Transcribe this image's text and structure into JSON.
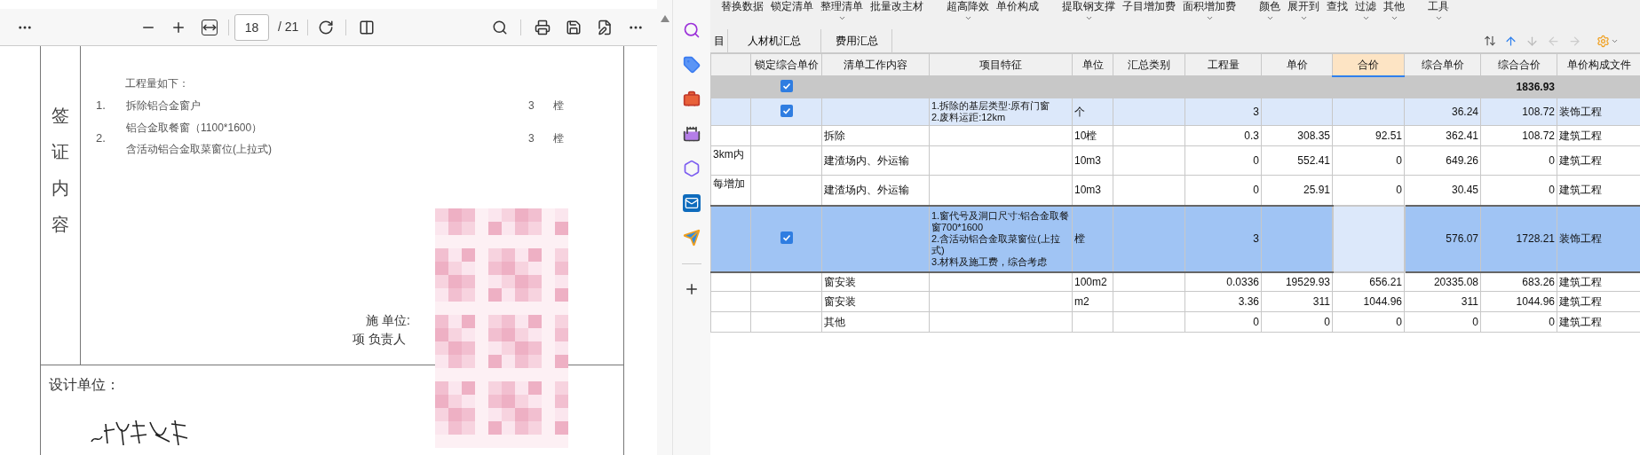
{
  "pdf": {
    "toolbar": {
      "page": "18",
      "total": "/ 21"
    },
    "page": {
      "side_label": "签证内容",
      "heading": "工程量如下：",
      "items": [
        {
          "number": "1.",
          "lines": [
            "拆除铝合金窗户"
          ],
          "qty": "3",
          "unit": "樘"
        },
        {
          "number": "2.",
          "lines": [
            "铝合金取餐窗（1100*1600）",
            "含活动铝合金取菜窗位(上拉式)"
          ],
          "qty": "3",
          "unit": "樘"
        }
      ],
      "contractor_label": "施 单位:",
      "manager_label": "项 负责人",
      "design_label": "设计单位："
    }
  },
  "app": {
    "toolbar_groups": [
      [
        {
          "label": "替换数据",
          "menu": false
        },
        {
          "label": "锁定清单",
          "menu": false
        },
        {
          "label": "整理清单",
          "menu": true
        },
        {
          "label": "批量改主材",
          "menu": false
        }
      ],
      [
        {
          "label": "超高降效",
          "menu": true
        },
        {
          "label": "单价构成",
          "menu": false
        }
      ],
      [
        {
          "label": "提取钢支撑",
          "menu": true
        },
        {
          "label": "子目增加费",
          "menu": false
        },
        {
          "label": "面积增加费",
          "menu": true
        }
      ],
      [
        {
          "label": "颜色",
          "menu": true
        },
        {
          "label": "展开到",
          "menu": true
        },
        {
          "label": "查找",
          "menu": false
        },
        {
          "label": "过滤",
          "menu": true
        },
        {
          "label": "其他",
          "menu": true
        }
      ],
      [
        {
          "label": "工具",
          "menu": true
        }
      ]
    ],
    "tabs": [
      {
        "label": "目",
        "selected": false
      },
      {
        "label": "人材机汇总",
        "selected": false
      },
      {
        "label": "费用汇总",
        "selected": false
      }
    ],
    "table": {
      "columns": [
        {
          "label": "锁定综合单价",
          "selected": false
        },
        {
          "label": "清单工作内容",
          "selected": false
        },
        {
          "label": "项目特征",
          "selected": false
        },
        {
          "label": "单位",
          "selected": false
        },
        {
          "label": "汇总类别",
          "selected": false
        },
        {
          "label": "工程量",
          "selected": false
        },
        {
          "label": "单价",
          "selected": false
        },
        {
          "label": "合价",
          "selected": true
        },
        {
          "label": "综合单价",
          "selected": false
        },
        {
          "label": "综合合价",
          "selected": false
        },
        {
          "label": "单价构成文件",
          "selected": false
        }
      ],
      "rows": [
        {
          "kind": "summary",
          "selected": false,
          "locked": true,
          "cells": [
            null,
            null,
            null,
            null,
            null,
            null,
            null,
            null,
            null,
            "1836.93",
            null
          ]
        },
        {
          "kind": "item",
          "selected": false,
          "locked": true,
          "cells": [
            null,
            null,
            "1.拆除的基层类型:原有门窗\n2.废料运距:12km",
            "个",
            null,
            "3",
            null,
            null,
            "36.24",
            "108.72",
            "装饰工程"
          ]
        },
        {
          "kind": "sub",
          "selected": false,
          "cells": [
            null,
            "拆除",
            null,
            "10樘",
            null,
            "0.3",
            "308.35",
            "92.51",
            "362.41",
            "108.72",
            "建筑工程"
          ]
        },
        {
          "kind": "sub",
          "selected": false,
          "row_header": "3km内",
          "cells": [
            null,
            "建渣场内、外运输",
            null,
            "10m3",
            null,
            "0",
            "552.41",
            "0",
            "649.26",
            "0",
            "建筑工程"
          ]
        },
        {
          "kind": "sub",
          "selected": false,
          "row_header": "每增加",
          "cells": [
            null,
            "建渣场内、外运输",
            null,
            "10m3",
            null,
            "0",
            "25.91",
            "0",
            "30.45",
            "0",
            "建筑工程"
          ]
        },
        {
          "kind": "item",
          "selected": true,
          "locked": true,
          "cells": [
            null,
            null,
            "1.窗代号及洞口尺寸:铝合金取餐窗700*1600\n2.含活动铝合金取菜窗位(上拉式)\n3.材料及施工费，综合考虑",
            "樘",
            null,
            "3",
            null,
            null,
            "576.07",
            "1728.21",
            "装饰工程"
          ]
        },
        {
          "kind": "sub",
          "selected": false,
          "cells": [
            null,
            "窗安装",
            null,
            "100m2",
            null,
            "0.0336",
            "19529.93",
            "656.21",
            "20335.08",
            "683.26",
            "建筑工程"
          ]
        },
        {
          "kind": "sub",
          "selected": false,
          "cells": [
            null,
            "窗安装",
            null,
            "m2",
            null,
            "3.36",
            "311",
            "1044.96",
            "311",
            "1044.96",
            "建筑工程"
          ]
        },
        {
          "kind": "sub",
          "selected": false,
          "cells": [
            null,
            "其他",
            null,
            null,
            null,
            "0",
            "0",
            "0",
            "0",
            "0",
            "建筑工程"
          ]
        }
      ]
    }
  }
}
